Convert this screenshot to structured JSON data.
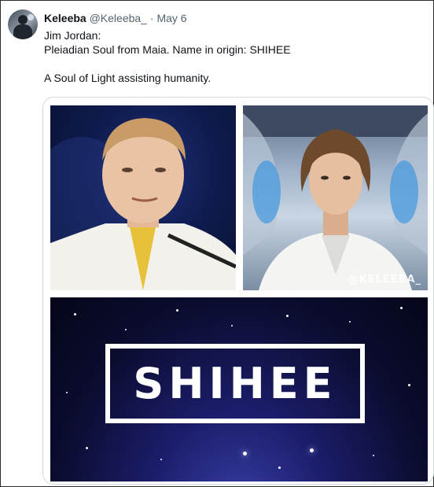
{
  "post": {
    "author_name": "Keleeba",
    "author_handle": "@Keleeba_",
    "separator": "·",
    "date": "May 6",
    "lines": [
      "Jim Jordan:",
      "Pleiadian Soul from Maia. Name in origin: SHIHEE",
      "",
      "A Soul of Light assisting humanity."
    ]
  },
  "media": {
    "images": [
      {
        "alt_icon": "photo-man-portrait"
      },
      {
        "alt_icon": "photo-illustrated-figure",
        "watermark": "@KELEEBA_"
      },
      {
        "alt_icon": "starfield-graphic",
        "title_text": "SHIHEE"
      }
    ]
  },
  "colors": {
    "text": "#0f1419",
    "secondary": "#536471",
    "border": "#cfd9de"
  }
}
